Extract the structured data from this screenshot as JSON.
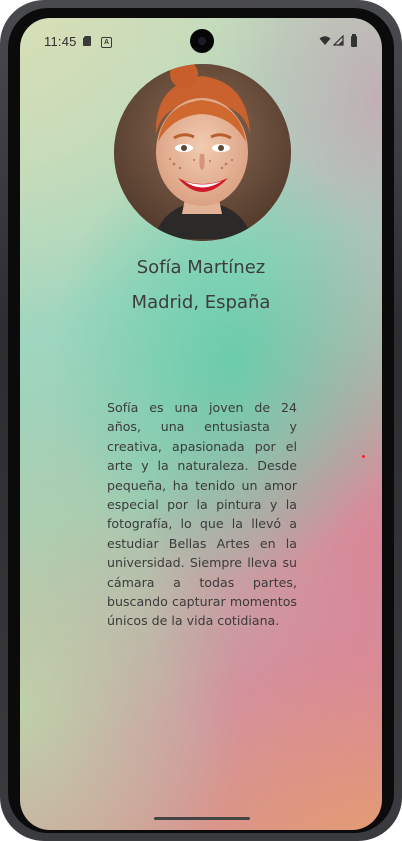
{
  "status_bar": {
    "time": "11:45",
    "icons": [
      "sd-card-icon",
      "a-icon",
      "wifi-icon",
      "signal-icon",
      "battery-icon"
    ],
    "a_label": "A"
  },
  "profile": {
    "name": "Sofía Martínez",
    "location": "Madrid, España",
    "bio": "Sofía es una joven de 24 años, una entusiasta y creativa, apasionada por el arte y la naturaleza. Desde pequeña, ha tenido un amor especial por la pintura y la fotografía, lo que la llevó a estudiar Bellas Artes en la universidad. Siempre lleva su cámara a todas partes, buscando capturar momentos únicos de la vida cotidiana."
  },
  "colors": {
    "text": "#3d3d3d",
    "accent_red": "#ff2020",
    "gradient_green": "#60cdaa",
    "gradient_pink": "#de8296",
    "gradient_orange": "#e4a06e"
  }
}
